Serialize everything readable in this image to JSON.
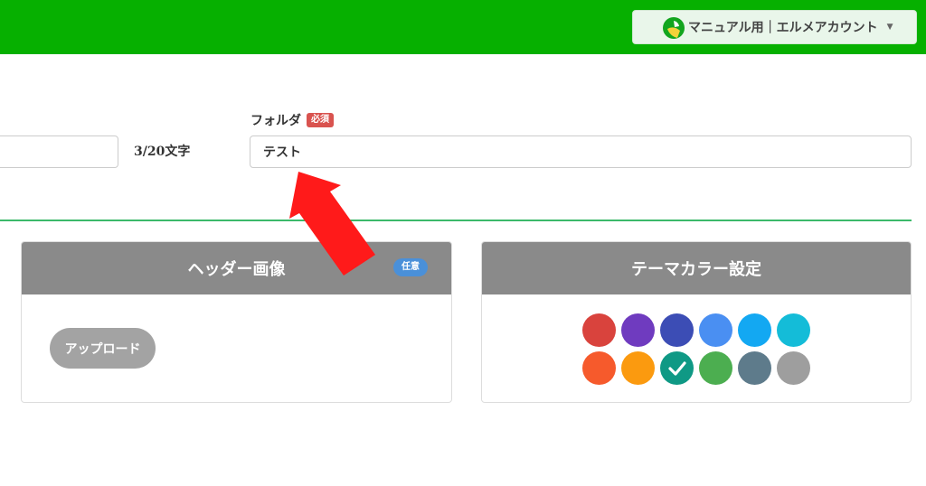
{
  "header": {
    "account_label": "マニュアル用｜エルメアカウント",
    "caret": "▼"
  },
  "form": {
    "char_count": "3/20文字",
    "folder_label": "フォルダ",
    "required_badge": "必須",
    "folder_value": "テスト"
  },
  "header_image_panel": {
    "title": "ヘッダー画像",
    "optional_badge": "任意",
    "upload_label": "アップロード"
  },
  "theme_panel": {
    "title": "テーマカラー設定",
    "colors_row1": [
      "#d9433d",
      "#6f3bbf",
      "#3c4db5",
      "#4a8ff2",
      "#13a8f2",
      "#14bcd8"
    ],
    "colors_row2": [
      "#f65a2c",
      "#fb9a0f",
      "#0f9985",
      "#4cae50",
      "#5e7b8b",
      "#9e9e9e"
    ],
    "selected_color": "#0f9985"
  },
  "colors": {
    "topbar": "#06b000",
    "divider": "#3cb96a",
    "arrow": "#ff1a1a"
  }
}
